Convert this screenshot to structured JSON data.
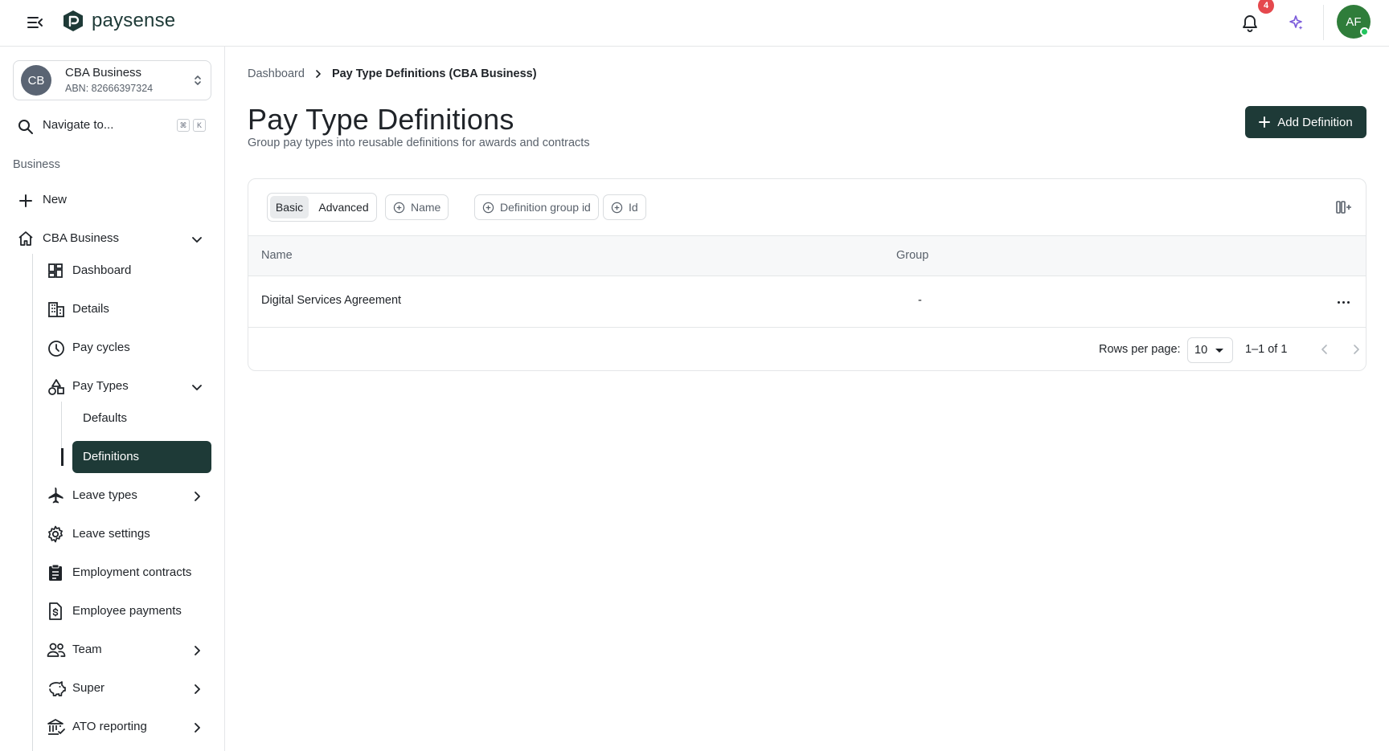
{
  "app": {
    "brand": "paysense",
    "notification_count": "4",
    "user_initials": "AF"
  },
  "business": {
    "initials": "CB",
    "name": "CBA Business",
    "abn": "ABN: 82666397324"
  },
  "sidebar": {
    "search_label": "Navigate to...",
    "shortcut_keys": [
      "⌘",
      "K"
    ],
    "section_title": "Business",
    "new_label": "New",
    "group_label": "CBA Business",
    "items": [
      {
        "label": "Dashboard",
        "icon": "dashboard-icon"
      },
      {
        "label": "Details",
        "icon": "building-icon"
      },
      {
        "label": "Pay cycles",
        "icon": "clock-icon"
      },
      {
        "label": "Pay Types",
        "icon": "shapes-icon"
      },
      {
        "label": "Defaults"
      },
      {
        "label": "Definitions"
      },
      {
        "label": "Leave types",
        "icon": "plane-icon"
      },
      {
        "label": "Leave settings",
        "icon": "gear-icon"
      },
      {
        "label": "Employment contracts",
        "icon": "clipboard-icon"
      },
      {
        "label": "Employee payments",
        "icon": "dollar-document-icon"
      },
      {
        "label": "Team",
        "icon": "people-icon"
      },
      {
        "label": "Super",
        "icon": "piggy-bank-icon"
      },
      {
        "label": "ATO reporting",
        "icon": "bank-icon"
      }
    ]
  },
  "main": {
    "breadcrumb": {
      "root": "Dashboard",
      "current": "Pay Type Definitions (CBA Business)"
    },
    "title": "Pay Type Definitions",
    "subtitle": "Group pay types into reusable definitions for awards and contracts",
    "add_button": "Add Definition",
    "filters": {
      "basic": "Basic",
      "advanced": "Advanced",
      "chips": [
        "Name",
        "Definition group id",
        "Id"
      ]
    },
    "table": {
      "columns": [
        "Name",
        "Group"
      ],
      "rows": [
        {
          "name": "Digital Services Agreement",
          "group": "-"
        }
      ]
    },
    "pagination": {
      "rows_per_page_label": "Rows per page:",
      "rows_per_page_value": "10",
      "range": "1–1 of 1"
    }
  },
  "colors": {
    "primary": "#1e3a37",
    "badge": "#e5484d",
    "avatar": "#2f7d3a",
    "sparkle": "#7c5cdb"
  }
}
